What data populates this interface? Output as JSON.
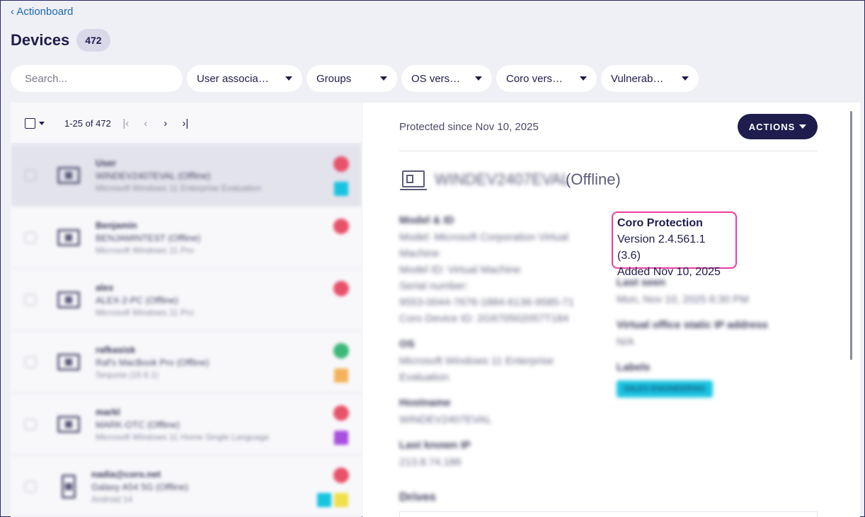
{
  "nav": {
    "back_label": "‹ Actionboard"
  },
  "header": {
    "title": "Devices",
    "count": "472"
  },
  "filters": {
    "search_placeholder": "Search...",
    "items": [
      {
        "label": "User associa…"
      },
      {
        "label": "Groups"
      },
      {
        "label": "OS vers…"
      },
      {
        "label": "Coro vers…"
      },
      {
        "label": "Vulnerab…"
      }
    ]
  },
  "list": {
    "pager_text": "1-25 of 472",
    "pager_icons": [
      "first-page-icon",
      "prev-page-icon",
      "next-page-icon",
      "last-page-icon"
    ],
    "rows": [
      {
        "user": "User",
        "device": "WINDEV2407EVAL (Offline)",
        "os": "Microsoft Windows 11 Enterprise Evaluation",
        "status_color": "#e8516a",
        "tags": [
          "#17c4e0"
        ],
        "icon": "laptop-icon"
      },
      {
        "user": "Benjamin",
        "device": "BENJAMINTEST (Offline)",
        "os": "Microsoft Windows 11 Pro",
        "status_color": "#e8516a",
        "tags": [],
        "icon": "laptop-icon"
      },
      {
        "user": "alex",
        "device": "ALEX-2-PC (Offline)",
        "os": "Microsoft Windows 11 Pro",
        "status_color": "#e8516a",
        "tags": [],
        "icon": "laptop-icon"
      },
      {
        "user": "rafkasisk",
        "device": "Raf's MacBook Pro (Offline)",
        "os": "Sequoia (15.6.1)",
        "status_color": "#3cb878",
        "tags": [
          "#f4b35a"
        ],
        "icon": "laptop-icon"
      },
      {
        "user": "markl",
        "device": "MARK-OTC (Offline)",
        "os": "Microsoft Windows 11 Home Single Language",
        "status_color": "#e8516a",
        "tags": [
          "#a84ee0"
        ],
        "icon": "laptop-icon"
      },
      {
        "user": "nadia@coro.net",
        "device": "Galaxy A54 5G (Offline)",
        "os": "Android 14",
        "status_color": "#e8516a",
        "tags": [
          "#17c4e0",
          "#f0e04a"
        ],
        "icon": "mobile-icon"
      }
    ]
  },
  "detail": {
    "protected_since": "Protected since Nov 10, 2025",
    "actions_label": "ACTIONS",
    "device_name": "WINDEV2407EVAL",
    "offline_label": "(Offline)",
    "model": {
      "title": "Model & ID",
      "lines": [
        "Model: Microsoft Corporation Virtual",
        "Machine",
        "Model ID: Virtual Machine",
        "Serial number:",
        "9553-0044-7676-1884-6136-9585-71",
        "Coro Device ID: 2G970502057T184"
      ]
    },
    "os": {
      "title": "OS",
      "lines": [
        "Microsoft Windows 11 Enterprise",
        "Evaluation"
      ]
    },
    "hostname": {
      "title": "Hostname",
      "lines": [
        "WINDEV2407EVAL"
      ]
    },
    "last_ip": {
      "title": "Last known IP",
      "lines": [
        "213.8.74.186"
      ]
    },
    "coro": {
      "title": "Coro Protection",
      "version": "Version 2.4.561.1 (3.6)",
      "added": "Added Nov 10, 2025"
    },
    "last_seen": {
      "title": "Last seen",
      "lines": [
        "Mon, Nov 10, 2025 6:30 PM"
      ]
    },
    "virtual_office": {
      "title": "Virtual office static IP address",
      "lines": [
        "N/A"
      ]
    },
    "labels": {
      "title": "Labels",
      "chip": "SALES ENGINEERING"
    },
    "drives_title": "Drives"
  },
  "colors": {
    "primary": "#1f1d4d",
    "highlight": "#e83e9f",
    "link": "#1b6aa8"
  }
}
